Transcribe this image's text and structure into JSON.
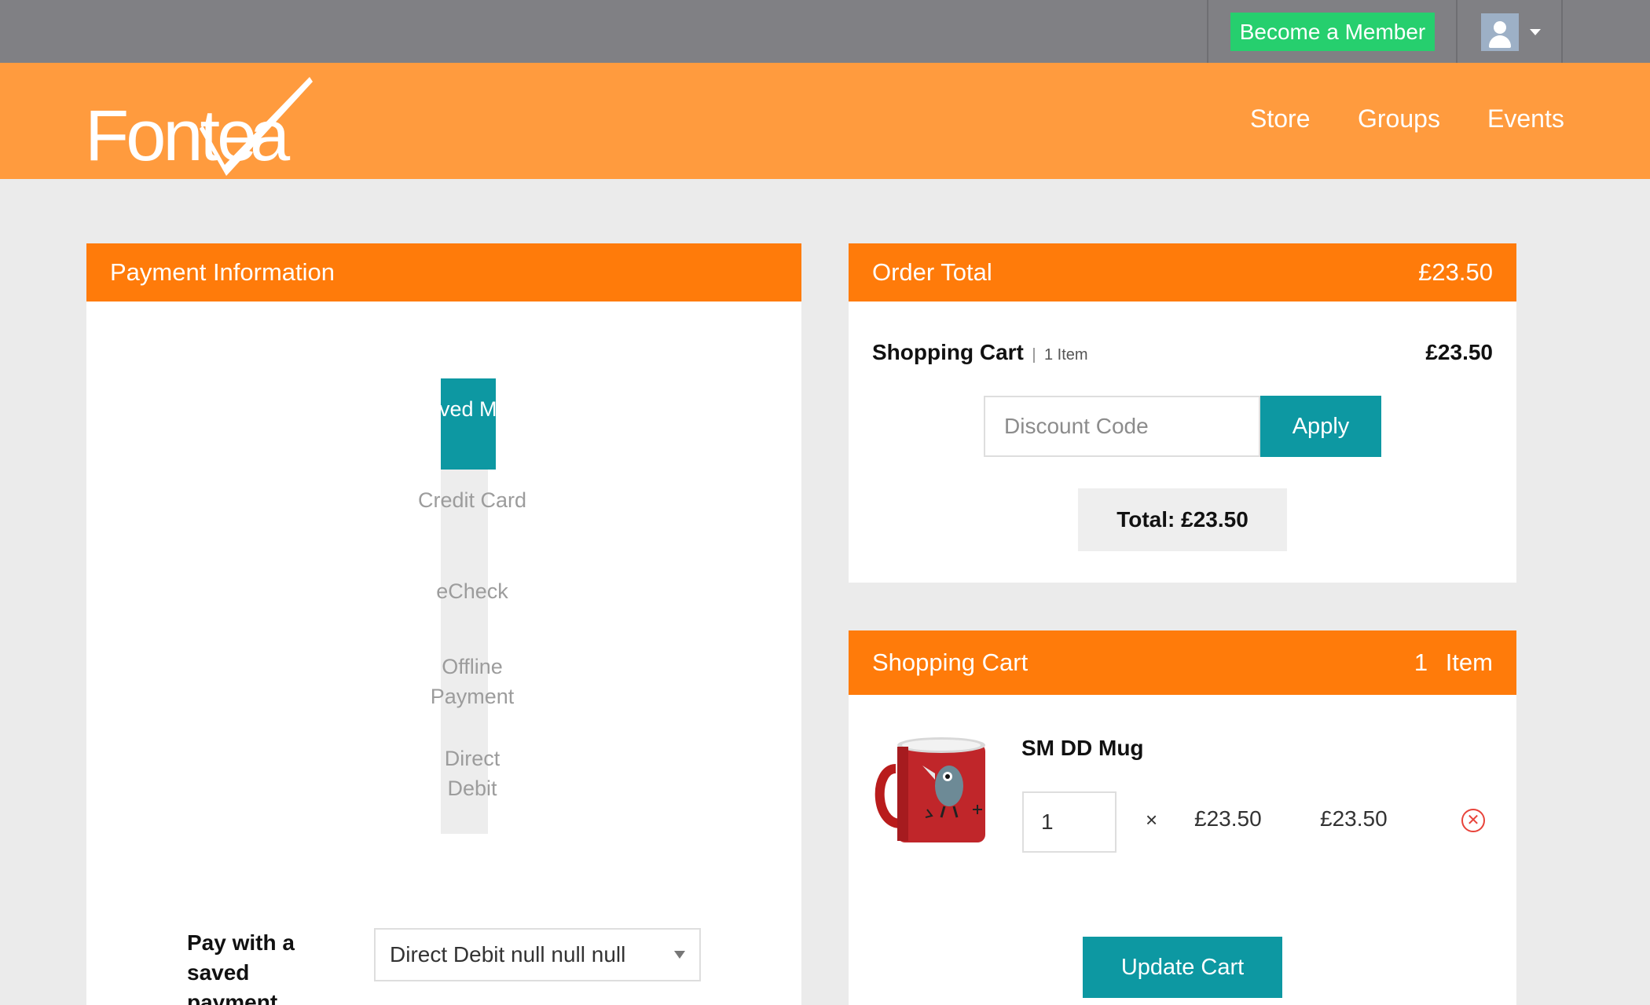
{
  "topbar": {
    "member_button": "Become a Member",
    "user_menu_icon": "user-avatar-icon"
  },
  "header": {
    "logo_text": "Fonteva",
    "nav": [
      "Store",
      "Groups",
      "Events"
    ]
  },
  "payment": {
    "title": "Payment Information",
    "tabs": [
      {
        "label": "Saved Method",
        "active": true
      },
      {
        "label": "Credit Card",
        "active": false
      },
      {
        "label": "eCheck",
        "active": false
      },
      {
        "label": "Offline Payment",
        "active": false
      },
      {
        "label": "Direct Debit",
        "active": false
      }
    ],
    "saved_label": "Pay with a saved payment",
    "saved_select_value": "Direct Debit null null null"
  },
  "order": {
    "title": "Order Total",
    "total": "£23.50",
    "cart_title": "Shopping Cart",
    "cart_separator": "|",
    "cart_count": "1 Item",
    "cart_amount": "£23.50",
    "discount_placeholder": "Discount Code",
    "apply_label": "Apply",
    "total_label": "Total: £23.50"
  },
  "cart": {
    "title": "Shopping Cart",
    "item_count": "1 Item",
    "items": [
      {
        "name": "SM DD Mug",
        "quantity": "1",
        "times": "×",
        "unit_price": "£23.50",
        "line_total": "£23.50"
      }
    ],
    "update_label": "Update Cart"
  },
  "colors": {
    "topbar": "#808084",
    "header": "#ff9b3e",
    "panel_head": "#ff7b0a",
    "teal": "#0d98a2",
    "member_green": "#26cf6e",
    "remove_red": "#e8433a"
  }
}
